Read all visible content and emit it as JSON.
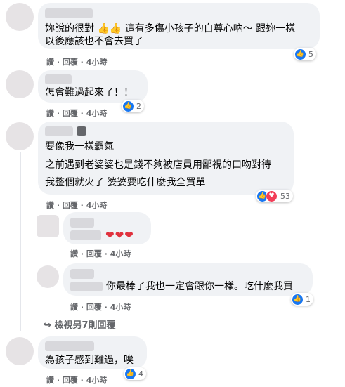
{
  "comments": [
    {
      "lines": [
        "妳說的很對 👍👍 這有多傷小孩子的自尊心吶～ 跟妳一樣",
        "以後應該也不會去買了"
      ],
      "meta": {
        "like": "讚",
        "reply": "回覆",
        "time": "4小時"
      },
      "reactions": {
        "types": [
          "like"
        ],
        "count": "5"
      }
    },
    {
      "lines": [
        "怎會難過起來了！！"
      ],
      "meta": {
        "like": "讚",
        "reply": "回覆",
        "time": "4小時"
      },
      "reactions": {
        "types": [
          "like"
        ],
        "count": "2"
      }
    },
    {
      "lines": [
        "要像我一樣霸氣",
        "之前遇到老婆婆也是錢不夠被店員用鄙視的口吻對待",
        "我整個就火了 婆婆要吃什麼我全買單"
      ],
      "meta": {
        "like": "讚",
        "reply": "回覆",
        "time": "4小時"
      },
      "reactions": {
        "types": [
          "like",
          "love"
        ],
        "count": "53"
      }
    }
  ],
  "replies": [
    {
      "lines": [
        "❤❤❤"
      ],
      "meta": {
        "like": "讚",
        "reply": "回覆",
        "time": "4小時"
      }
    },
    {
      "lines": [
        "你最棒了我也一定會跟你一樣。吃什麼我買"
      ],
      "meta": {
        "like": "讚",
        "reply": "回覆",
        "time": "4小時"
      },
      "reactions": {
        "types": [
          "like"
        ],
        "count": "1"
      }
    }
  ],
  "view_more_replies": "檢視另7則回覆",
  "last_comment": {
    "lines": [
      "為孩子感到難過，唉"
    ],
    "meta": {
      "like": "讚",
      "reply": "回覆",
      "time": "4小時"
    },
    "reactions": {
      "types": [
        "like"
      ],
      "count": "4"
    }
  },
  "colors": {
    "like": "#1877f2",
    "love": "#f33e58",
    "bubble": "#f0f2f5",
    "meta": "#65676b"
  }
}
